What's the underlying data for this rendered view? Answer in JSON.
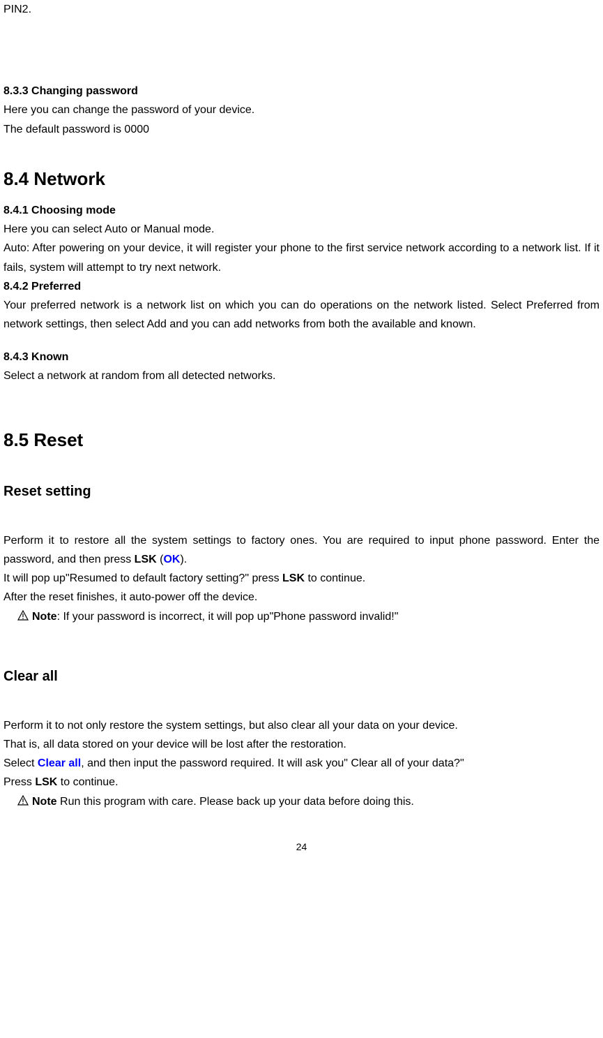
{
  "top_fragment": "PIN2.",
  "s833": {
    "heading": "8.3.3 Changing password",
    "line1": "Here you can change the password of your device.",
    "line2": "The default password is 0000"
  },
  "s84": {
    "heading": "8.4 Network",
    "s841_heading": "8.4.1 Choosing mode",
    "s841_line1": "Here you can select Auto or Manual mode.",
    "s841_line2": "Auto: After powering on your device, it will register your phone to the first service network according to a network list. If it fails, system will attempt to try next network.",
    "s842_heading": "8.4.2  Preferred",
    "s842_line1": "Your preferred network is a network list on which you can do operations on the network listed. Select Preferred from network settings, then select Add and you can add networks from both the available and known.",
    "s843_heading": "8.4.3 Known",
    "s843_line1": "Select a network at random from all detected networks."
  },
  "s85": {
    "heading": "8.5 Reset",
    "reset_heading": "Reset setting",
    "reset_p1_a": "Perform it to restore all the system settings to factory ones. You are required to input phone password. Enter the password, and then press ",
    "reset_lsk": "LSK",
    "reset_open": " (",
    "reset_ok": "OK",
    "reset_close": ").",
    "reset_p2_a": "It will pop up\"Resumed to default factory setting?\" press ",
    "reset_p2_b": " to continue.",
    "reset_p3": "After the reset finishes, it auto-power off the device.",
    "reset_note_label": "Note",
    "reset_note_text": ": If your password is incorrect, it will pop up\"Phone password invalid!\"",
    "clear_heading": "Clear all",
    "clear_p1": "Perform it to not only restore the system settings, but also clear all your data on your device.",
    "clear_p2": "That is, all data stored on your device will be lost after the restoration.",
    "clear_p3_a": "Select ",
    "clear_all_label": "Clear all",
    "clear_p3_b": ", and then input the password required. It will ask you\" Clear all of your data?\"",
    "clear_p4_a": "Press ",
    "clear_p4_b": " to continue.",
    "clear_note_label": "Note",
    "clear_note_text": " Run this program with care. Please back up your data before doing this."
  },
  "page_number": "24"
}
